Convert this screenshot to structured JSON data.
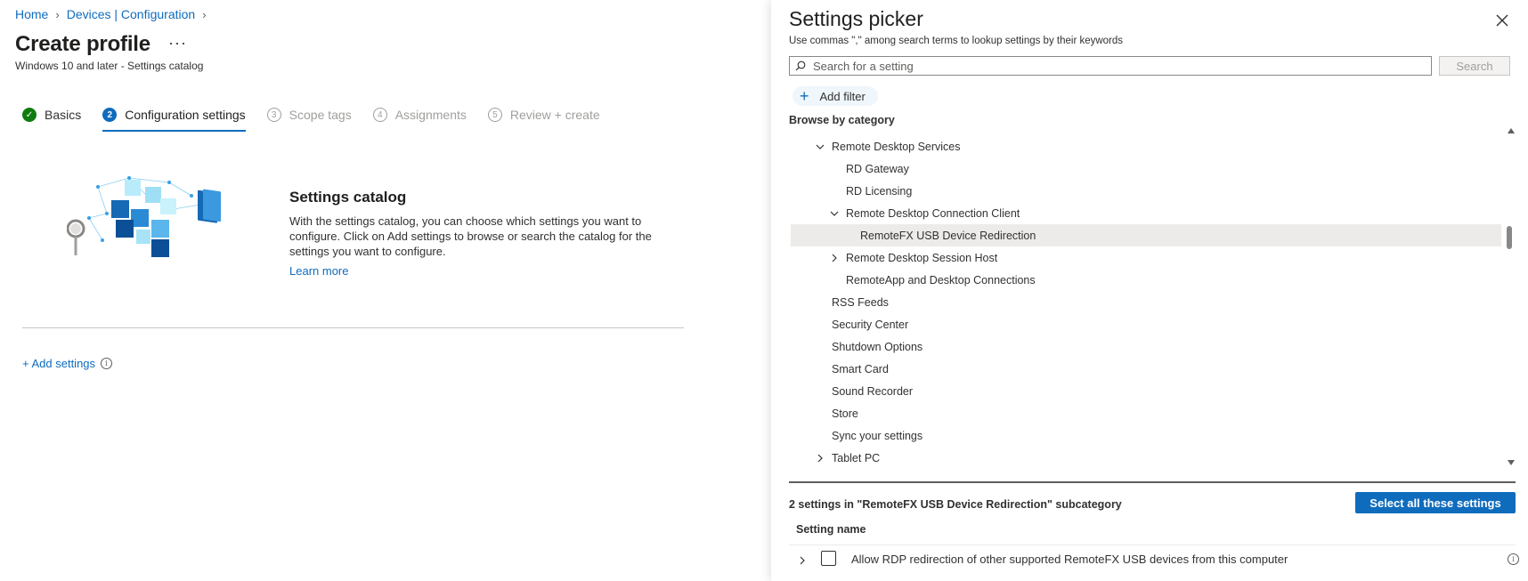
{
  "breadcrumb": {
    "home": "Home",
    "devices": "Devices | Configuration"
  },
  "page": {
    "title": "Create profile",
    "more": "···",
    "subtitle": "Windows 10 and later - Settings catalog"
  },
  "steps": [
    {
      "num": "✓",
      "label": "Basics",
      "state": "done"
    },
    {
      "num": "2",
      "label": "Configuration settings",
      "state": "active"
    },
    {
      "num": "3",
      "label": "Scope tags",
      "state": "pending"
    },
    {
      "num": "4",
      "label": "Assignments",
      "state": "pending"
    },
    {
      "num": "5",
      "label": "Review + create",
      "state": "pending"
    }
  ],
  "catalog": {
    "title": "Settings catalog",
    "description": "With the settings catalog, you can choose which settings you want to configure. Click on Add settings to browse or search the catalog for the settings you want to configure.",
    "learn_more": "Learn more",
    "add_settings": "+ Add settings",
    "illustration": "settings-catalog-cubes-illustration"
  },
  "picker": {
    "title": "Settings picker",
    "hint": "Use commas \",\" among search terms to lookup settings by their keywords",
    "search_placeholder": "Search for a setting",
    "search_button": "Search",
    "add_filter": "Add filter",
    "browse_label": "Browse by category",
    "tree": [
      {
        "label": "Remote Desktop Services",
        "level": 1,
        "expander": "down"
      },
      {
        "label": "RD Gateway",
        "level": 2,
        "expander": "none"
      },
      {
        "label": "RD Licensing",
        "level": 2,
        "expander": "none"
      },
      {
        "label": "Remote Desktop Connection Client",
        "level": 2,
        "expander": "down"
      },
      {
        "label": "RemoteFX USB Device Redirection",
        "level": 3,
        "expander": "none",
        "selected": true
      },
      {
        "label": "Remote Desktop Session Host",
        "level": 2,
        "expander": "right"
      },
      {
        "label": "RemoteApp and Desktop Connections",
        "level": 2,
        "expander": "none"
      },
      {
        "label": "RSS Feeds",
        "level": 1,
        "expander": "none"
      },
      {
        "label": "Security Center",
        "level": 1,
        "expander": "none"
      },
      {
        "label": "Shutdown Options",
        "level": 1,
        "expander": "none"
      },
      {
        "label": "Smart Card",
        "level": 1,
        "expander": "none"
      },
      {
        "label": "Sound Recorder",
        "level": 1,
        "expander": "none"
      },
      {
        "label": "Store",
        "level": 1,
        "expander": "none"
      },
      {
        "label": "Sync your settings",
        "level": 1,
        "expander": "none"
      },
      {
        "label": "Tablet PC",
        "level": 1,
        "expander": "right"
      }
    ],
    "subcategory_count": "2 settings in \"RemoteFX USB Device Redirection\" subcategory",
    "select_all": "Select all these settings",
    "column_header": "Setting name",
    "settings": [
      {
        "label": "Allow RDP redirection of other supported RemoteFX USB devices from this computer",
        "checked": false
      }
    ]
  },
  "colors": {
    "accent": "#0f6cbd",
    "success": "#107c10",
    "selected_row": "#edebe9"
  }
}
